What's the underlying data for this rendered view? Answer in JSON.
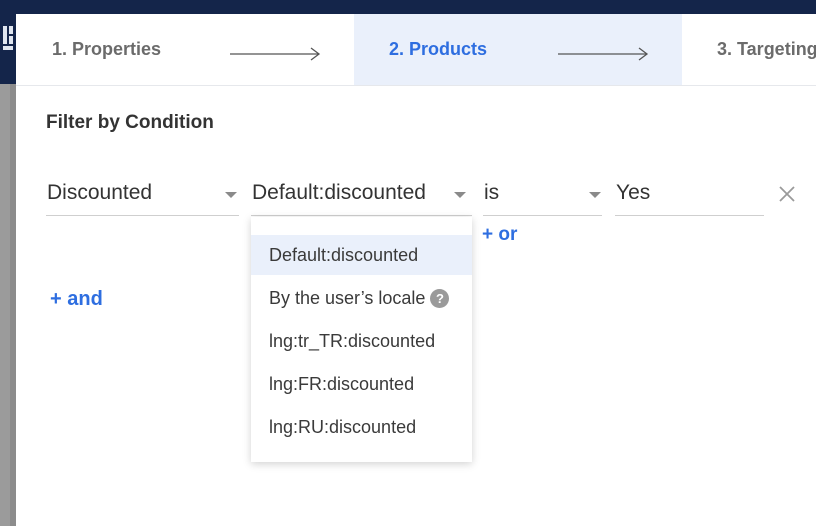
{
  "steps": [
    {
      "label": "1. Properties"
    },
    {
      "label": "2. Products"
    },
    {
      "label": "3. Targeting"
    }
  ],
  "active_step": 2,
  "filter": {
    "title": "Filter by Condition",
    "attribute": "Discounted",
    "namespace": "Default:discounted",
    "operator": "is",
    "value": "Yes"
  },
  "links": {
    "or": "+ or",
    "and": "+ and"
  },
  "dropdown": {
    "options": [
      {
        "label": "Default:discounted",
        "selected": true
      },
      {
        "label": "By the user’s locale",
        "help_icon": "question-mark",
        "help_glyph": "?"
      },
      {
        "label": "lng:tr_TR:discounted"
      },
      {
        "label": "lng:FR:discounted"
      },
      {
        "label": "lng:RU:discounted"
      }
    ]
  },
  "colors": {
    "accent": "#2e6ee0",
    "active_step_bg": "#eaf0fb",
    "topbar": "#14254a"
  }
}
